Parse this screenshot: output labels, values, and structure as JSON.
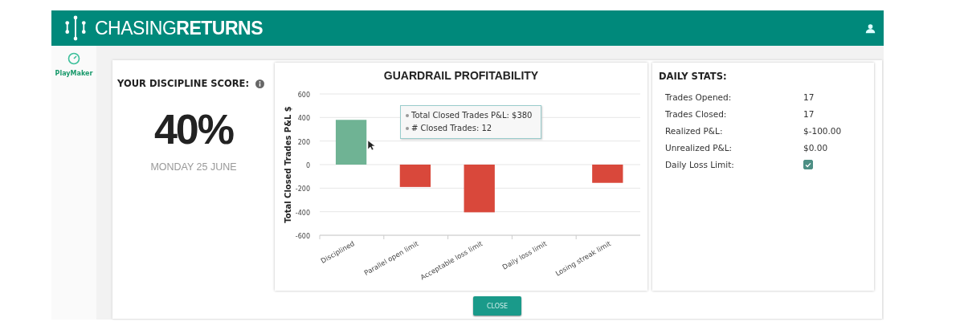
{
  "header": {
    "brand_light": "CHASING",
    "brand_bold": "RETURNS"
  },
  "sidebar": {
    "items": [
      {
        "label": "PlayMaker",
        "selected": true
      }
    ]
  },
  "score": {
    "title": "YOUR DISCIPLINE SCORE:",
    "value": "40%",
    "date": "MONDAY 25 JUNE"
  },
  "chart": {
    "chart_data": {
      "type": "bar",
      "title": "GUARDRAIL PROFITABILITY",
      "ylabel": "Total Closed Trades P&L $",
      "categories": [
        "Disciplined",
        "Parallel open limit",
        "Acceptable loss limit",
        "Daily loss limit",
        "Losing streak limit"
      ],
      "values": [
        380,
        -190,
        -405,
        0,
        -155
      ],
      "colors": [
        "#6fb394",
        "#d9483b",
        "#d9483b",
        null,
        "#d9483b"
      ],
      "grid": true,
      "ylim": [
        -600,
        600
      ],
      "yticks": [
        -600,
        -400,
        -200,
        0,
        200,
        400,
        600
      ]
    },
    "tooltip": [
      "Total Closed Trades P&L: $380",
      "# Closed Trades: 12"
    ]
  },
  "daily_stats": {
    "title": "DAILY STATS:",
    "rows": [
      {
        "kind": "text",
        "label": "Trades Opened:",
        "value": "17"
      },
      {
        "kind": "text",
        "label": "Trades Closed:",
        "value": "17"
      },
      {
        "kind": "text",
        "label": "Realized P&L:",
        "value": "$-100.00"
      },
      {
        "kind": "text",
        "label": "Unrealized P&L:",
        "value": "$0.00"
      },
      {
        "kind": "checkbox",
        "label": "Daily Loss Limit:",
        "checked": true
      }
    ]
  },
  "close_button": "CLOSE"
}
